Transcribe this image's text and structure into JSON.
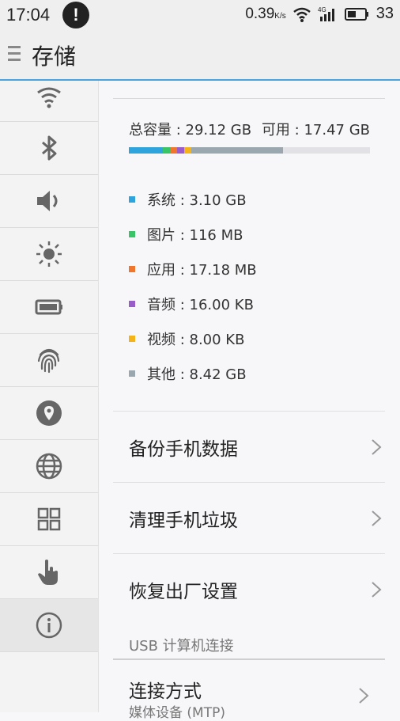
{
  "status_bar": {
    "time": "17:04",
    "speed": "0.39",
    "speed_unit": "K/s",
    "battery": "33",
    "network": "4G"
  },
  "header": {
    "title": "存储"
  },
  "sidebar": {
    "items": [
      {
        "icon": "wifi-icon"
      },
      {
        "icon": "bluetooth-icon"
      },
      {
        "icon": "volume-icon"
      },
      {
        "icon": "brightness-icon"
      },
      {
        "icon": "battery-icon"
      },
      {
        "icon": "fingerprint-icon"
      },
      {
        "icon": "location-icon"
      },
      {
        "icon": "globe-icon"
      },
      {
        "icon": "apps-grid-icon"
      },
      {
        "icon": "gesture-hand-icon"
      },
      {
        "icon": "info-icon",
        "active": true
      }
    ]
  },
  "storage": {
    "total": "总容量 : 29.12 GB",
    "available": "可用 : 17.47 GB",
    "used_fraction": 0.64,
    "legend": [
      {
        "label": "系统 : 3.10 GB",
        "color": "#2ea3dc"
      },
      {
        "label": "图片 : 116 MB",
        "color": "#39c467"
      },
      {
        "label": "应用 : 17.18 MB",
        "color": "#f0762e"
      },
      {
        "label": "音频 : 16.00 KB",
        "color": "#9a5cc9"
      },
      {
        "label": "视频 : 8.00 KB",
        "color": "#f4b31b"
      },
      {
        "label": "其他 : 8.42 GB",
        "color": "#9aa7ae"
      }
    ]
  },
  "actions": [
    {
      "label": "备份手机数据"
    },
    {
      "label": "清理手机垃圾"
    },
    {
      "label": "恢复出厂设置"
    }
  ],
  "usb_section": {
    "label": "USB 计算机连接",
    "connection_title": "连接方式",
    "connection_value": "媒体设备 (MTP)"
  }
}
